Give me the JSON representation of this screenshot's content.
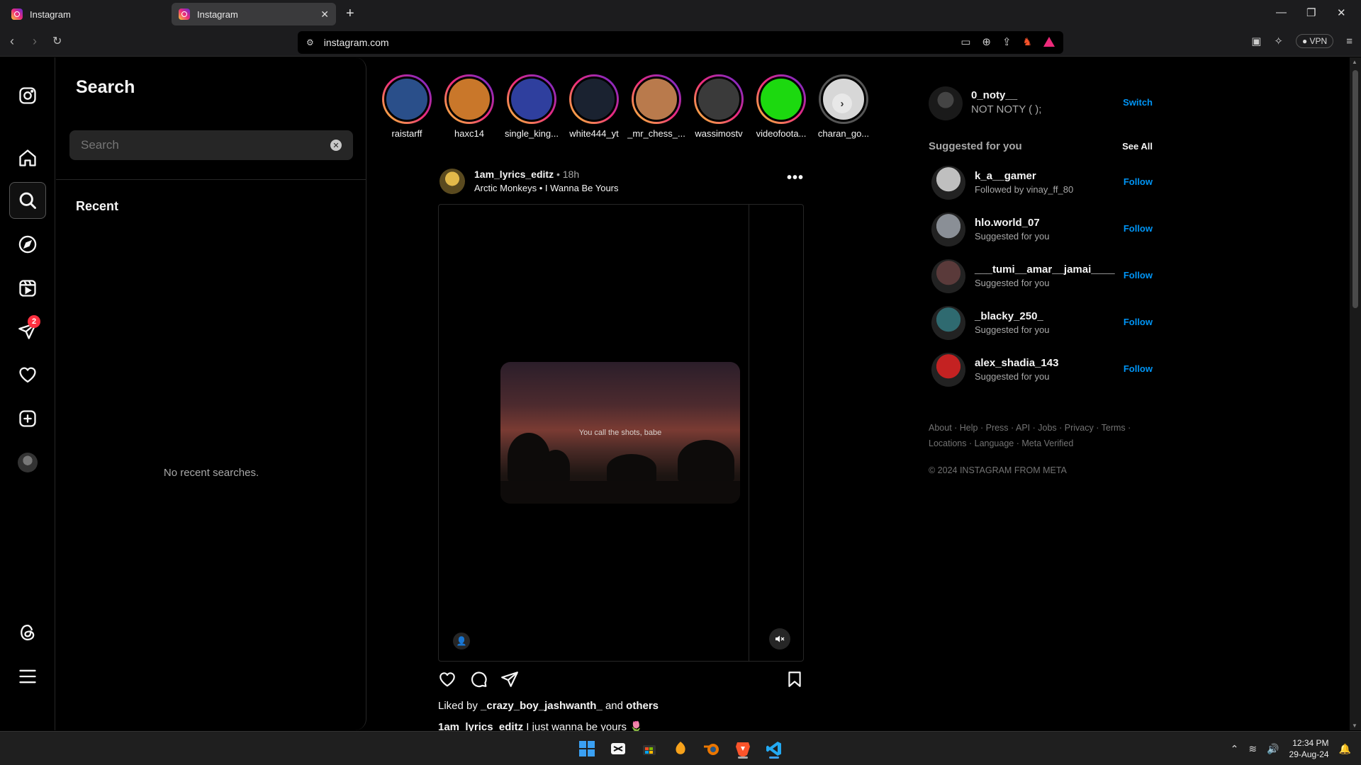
{
  "browser": {
    "tabs": [
      {
        "title": "Instagram",
        "active": false
      },
      {
        "title": "Instagram",
        "active": true
      }
    ],
    "new_tab_label": "+",
    "url": "instagram.com",
    "vpn_label": "VPN"
  },
  "rail": {
    "items": [
      "instagram-logo",
      "home",
      "search",
      "explore",
      "reels",
      "messages",
      "notifications",
      "create",
      "profile",
      "threads",
      "more"
    ],
    "messages_badge": "2"
  },
  "search_panel": {
    "title": "Search",
    "placeholder": "Search",
    "recent_title": "Recent",
    "empty_text": "No recent searches."
  },
  "stories": [
    {
      "name": "raistarff",
      "color": "#2a4f8a"
    },
    {
      "name": "haxc14",
      "color": "#c9772a"
    },
    {
      "name": "single_king...",
      "color": "#2f3f9e"
    },
    {
      "name": "white444_yt",
      "color": "#1a2230"
    },
    {
      "name": "_mr_chess_...",
      "color": "#b97a4c"
    },
    {
      "name": "wassimostv",
      "color": "#3a3a3a"
    },
    {
      "name": "videofoota...",
      "color": "#1cd90f"
    },
    {
      "name": "charan_go...",
      "color": "#d7d7d7"
    }
  ],
  "post": {
    "username": "1am_lyrics_editz",
    "time": "18h",
    "artist": "Arctic Monkeys",
    "song": "I Wanna Be Yours",
    "video_caption": "You call the shots, babe",
    "liked_by_prefix": "Liked by",
    "liked_by_user": "_crazy_boy_jashwanth_",
    "liked_by_and": "and",
    "liked_by_others": "others",
    "caption_user": "1am_lyrics_editz",
    "caption_text": "I just wanna be yours 🌷"
  },
  "account": {
    "username": "0_noty__",
    "display_name": "NOT NOTY ( );",
    "switch_label": "Switch"
  },
  "suggestions": {
    "title": "Suggested for you",
    "see_all": "See All",
    "follow_label": "Follow",
    "items": [
      {
        "username": "k_a__gamer",
        "sub": "Followed by vinay_ff_80",
        "color": "#bfbfbf"
      },
      {
        "username": "hlo.world_07",
        "sub": "Suggested for you",
        "color": "#8a8f96"
      },
      {
        "username": "___tumi__amar__jamai____",
        "sub": "Suggested for you",
        "color": "#5a3a3a"
      },
      {
        "username": "_blacky_250_",
        "sub": "Suggested for you",
        "color": "#2f6a70"
      },
      {
        "username": "alex_shadia_143",
        "sub": "Suggested for you",
        "color": "#c42222"
      }
    ]
  },
  "footer": {
    "links": [
      "About",
      "Help",
      "Press",
      "API",
      "Jobs",
      "Privacy",
      "Terms",
      "Locations",
      "Language",
      "Meta Verified"
    ],
    "copyright": "© 2024 INSTAGRAM FROM META"
  },
  "taskbar": {
    "time": "12:34 PM",
    "date": "29-Aug-24"
  }
}
